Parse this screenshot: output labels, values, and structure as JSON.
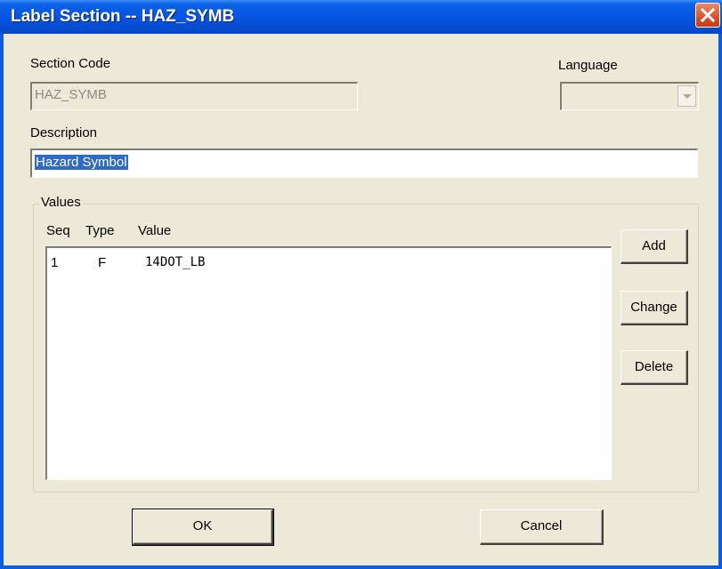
{
  "window": {
    "title": "Label Section -- HAZ_SYMB"
  },
  "section_code": {
    "label": "Section Code",
    "value": "HAZ_SYMB"
  },
  "language": {
    "label": "Language",
    "value": ""
  },
  "description": {
    "label": "Description",
    "value": "Hazard Symbol"
  },
  "values_group": {
    "title": "Values",
    "columns": [
      "Seq",
      "Type",
      "Value"
    ],
    "rows": [
      {
        "seq": "1",
        "type": "F",
        "value": "14DOT_LB"
      }
    ]
  },
  "side_buttons": {
    "add": "Add",
    "change": "Change",
    "delete": "Delete"
  },
  "footer": {
    "ok": "OK",
    "cancel": "Cancel"
  },
  "colors": {
    "titlebar": "#0554e0",
    "selection": "#316ac5",
    "dialog_bg": "#ece9d8",
    "close": "#d9502c"
  }
}
